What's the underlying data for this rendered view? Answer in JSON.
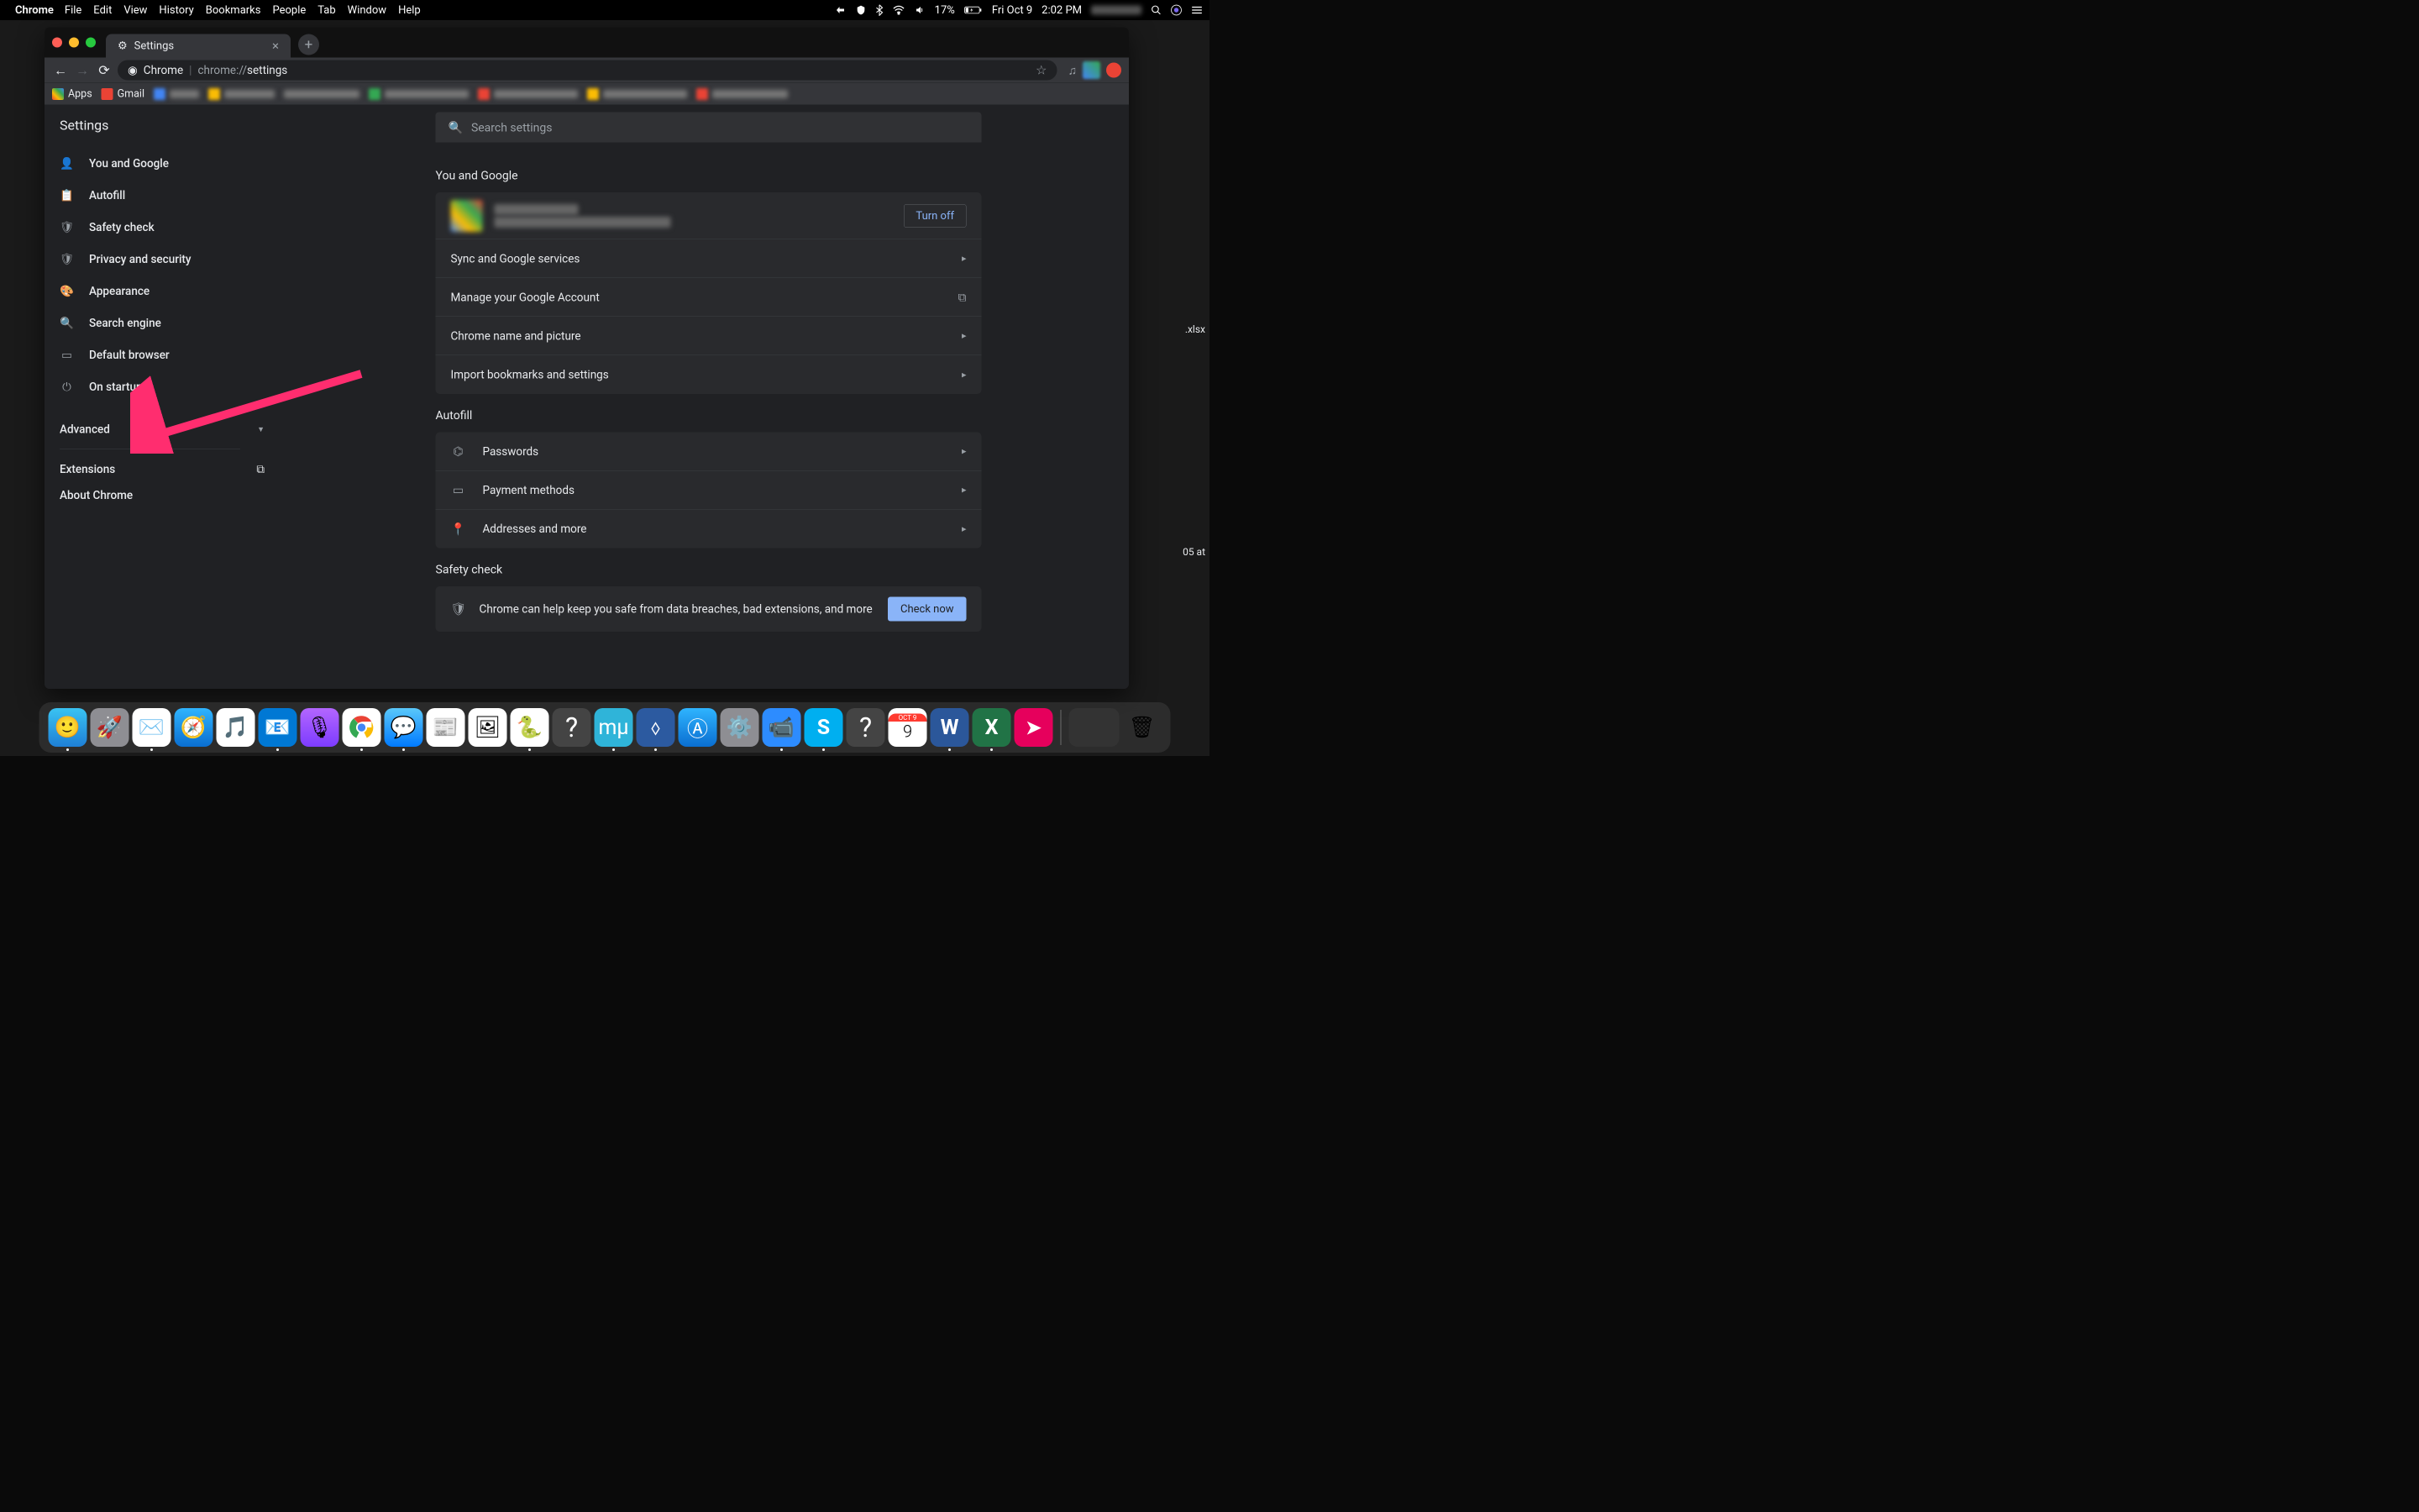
{
  "menubar": {
    "app": "Chrome",
    "items": [
      "File",
      "Edit",
      "View",
      "History",
      "Bookmarks",
      "People",
      "Tab",
      "Window",
      "Help"
    ],
    "battery": "17%",
    "date": "Fri Oct 9",
    "time": "2:02 PM"
  },
  "tab": {
    "title": "Settings"
  },
  "omnibox": {
    "chip": "Chrome",
    "url_prefix": "chrome://",
    "url_path": "settings"
  },
  "bookmarks": {
    "apps": "Apps",
    "gmail": "Gmail"
  },
  "settings_title": "Settings",
  "search": {
    "placeholder": "Search settings"
  },
  "sidebar": {
    "items": [
      {
        "label": "You and Google"
      },
      {
        "label": "Autofill"
      },
      {
        "label": "Safety check"
      },
      {
        "label": "Privacy and security"
      },
      {
        "label": "Appearance"
      },
      {
        "label": "Search engine"
      },
      {
        "label": "Default browser"
      },
      {
        "label": "On startup"
      }
    ],
    "advanced": "Advanced",
    "extensions": "Extensions",
    "about": "About Chrome"
  },
  "sections": {
    "you_google": {
      "title": "You and Google",
      "turn_off": "Turn off",
      "rows": [
        "Sync and Google services",
        "Manage your Google Account",
        "Chrome name and picture",
        "Import bookmarks and settings"
      ]
    },
    "autofill": {
      "title": "Autofill",
      "rows": [
        "Passwords",
        "Payment methods",
        "Addresses and more"
      ]
    },
    "safety": {
      "title": "Safety check",
      "text": "Chrome can help keep you safe from data breaches, bad extensions, and more",
      "button": "Check now"
    }
  },
  "desktop": {
    "file1": ".xlsx",
    "file2": "05 at"
  },
  "dock": {
    "icons": [
      "finder",
      "launchpad",
      "mail",
      "safari",
      "music",
      "outlook",
      "podcasts",
      "chrome",
      "messages",
      "news",
      "preview",
      "python",
      "help",
      "musescore",
      "vscode",
      "appstore",
      "sysprefs",
      "zoom",
      "skype",
      "help2",
      "calendar",
      "word",
      "excel",
      "clipboard"
    ],
    "date_badge": "OCT 9"
  }
}
